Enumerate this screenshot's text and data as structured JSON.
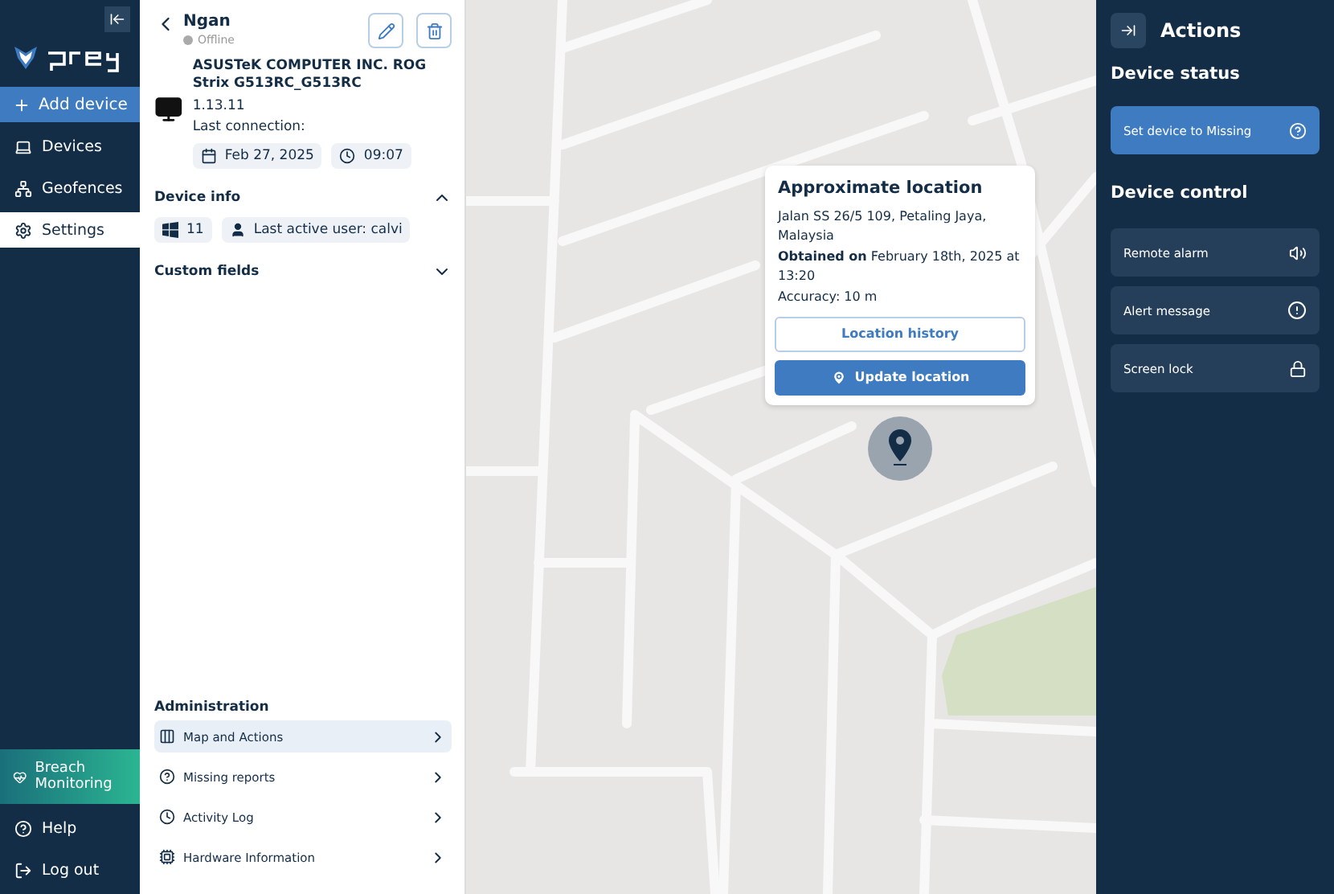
{
  "sidebar": {
    "add_button": "Add device",
    "items": [
      {
        "label": "Devices",
        "selected": false
      },
      {
        "label": "Geofences",
        "selected": false
      },
      {
        "label": "Settings",
        "selected": true
      }
    ],
    "breach": "Breach Monitoring",
    "bottom_items": [
      {
        "label": "Help"
      },
      {
        "label": "Log out"
      }
    ]
  },
  "device": {
    "name": "Ngan",
    "status": "Offline",
    "online": false,
    "model": "ASUSTeK COMPUTER INC. ROG Strix G513RC_G513RC",
    "version": "1.13.11",
    "last_connection_label": "Last connection:",
    "date": "Feb 27, 2025",
    "time": "09:07"
  },
  "sections": [
    {
      "title": "Device info",
      "expanded": true,
      "chips": [
        "11",
        "Last active user: calvi"
      ]
    },
    {
      "title": "Custom fields",
      "expanded": false
    }
  ],
  "administration": {
    "title": "Administration",
    "items": [
      {
        "label": "Map and Actions",
        "selected": true
      },
      {
        "label": "Missing reports",
        "selected": false
      },
      {
        "label": "Activity Log",
        "selected": false
      },
      {
        "label": "Hardware Information",
        "selected": false
      }
    ]
  },
  "location_popup": {
    "title": "Approximate location",
    "address": "Jalan SS 26/5 109, Petaling Jaya, Malaysia",
    "obtained": "**Obtained on** February 18th, 2025 at 13:20",
    "accuracy": "Accuracy: 10 m",
    "history_button": "Location history",
    "update_button": "Update location"
  },
  "actions": {
    "title": "Actions",
    "status_title": "Device status",
    "missing_button": "Set device to Missing",
    "control_title": "Device control",
    "controls": [
      "Remote alarm",
      "Alert message",
      "Screen lock"
    ]
  }
}
